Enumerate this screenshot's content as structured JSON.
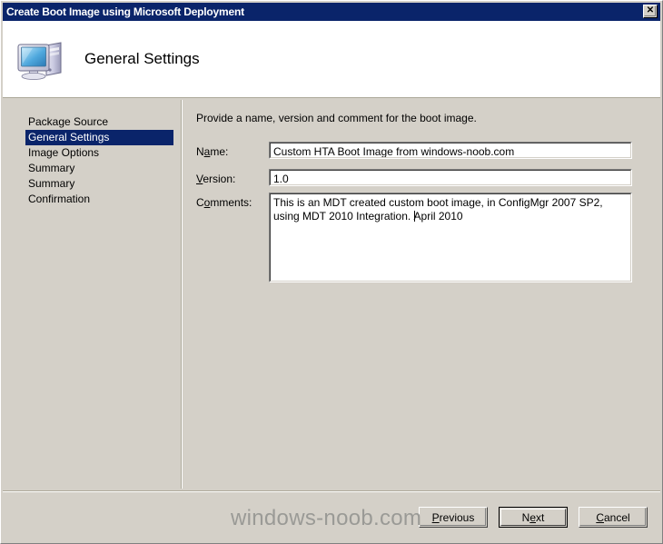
{
  "window": {
    "title": "Create Boot Image using Microsoft Deployment",
    "close_glyph": "✕"
  },
  "header": {
    "title": "General Settings",
    "icon": "computer-monitor-icon"
  },
  "sidebar": {
    "items": [
      {
        "label": "Package Source",
        "selected": false
      },
      {
        "label": "General Settings",
        "selected": true
      },
      {
        "label": "Image Options",
        "selected": false
      },
      {
        "label": "Summary",
        "selected": false
      },
      {
        "label": "Summary",
        "selected": false
      },
      {
        "label": "Confirmation",
        "selected": false
      }
    ]
  },
  "content": {
    "intro": "Provide a name, version and comment for the boot image.",
    "fields": {
      "name": {
        "label_pre": "N",
        "label_key": "a",
        "label_post": "me:",
        "value": "Custom HTA  Boot Image from windows-noob.com"
      },
      "version": {
        "label_pre": "",
        "label_key": "V",
        "label_post": "ersion:",
        "value": "1.0"
      },
      "comments": {
        "label_pre": "C",
        "label_key": "o",
        "label_post": "mments:",
        "value_part1": "This is an MDT created custom boot image, in ConfigMgr 2007 SP2, using MDT 2010 Integration. ",
        "value_part2": "April 2010"
      }
    }
  },
  "footer": {
    "buttons": [
      {
        "pre": "",
        "key": "P",
        "post": "revious",
        "default": false
      },
      {
        "pre": "N",
        "key": "e",
        "post": "xt",
        "default": true
      },
      {
        "pre": "",
        "key": "C",
        "post": "ancel",
        "default": false
      }
    ]
  },
  "watermark": "windows-noob.com"
}
